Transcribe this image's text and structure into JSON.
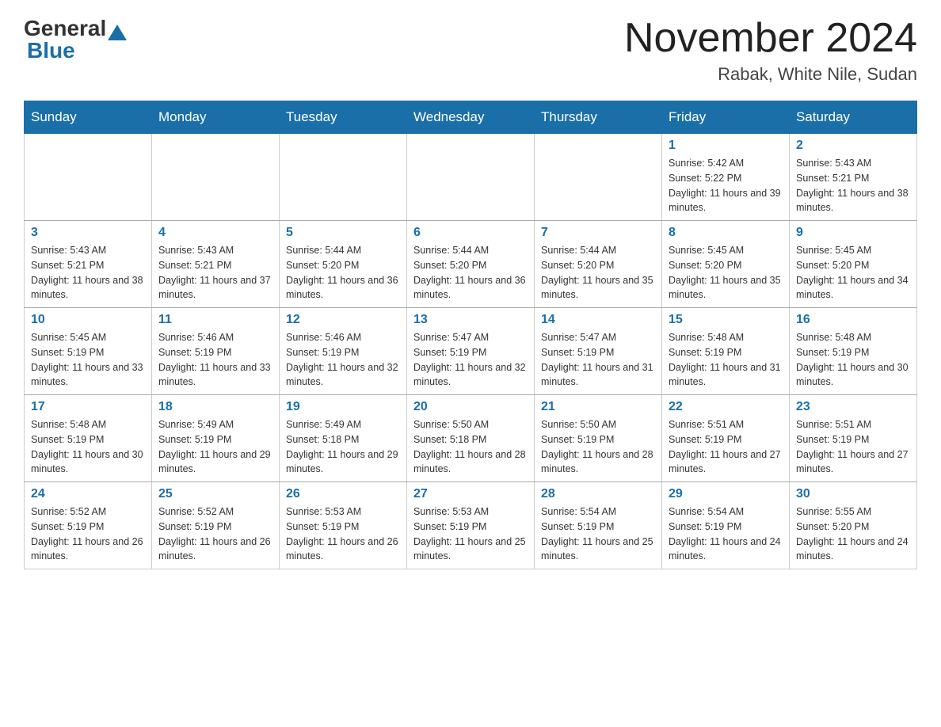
{
  "header": {
    "logo_general": "General",
    "logo_blue": "Blue",
    "month_title": "November 2024",
    "location": "Rabak, White Nile, Sudan"
  },
  "days_of_week": [
    "Sunday",
    "Monday",
    "Tuesday",
    "Wednesday",
    "Thursday",
    "Friday",
    "Saturday"
  ],
  "weeks": [
    [
      {
        "day": "",
        "sunrise": "",
        "sunset": "",
        "daylight": ""
      },
      {
        "day": "",
        "sunrise": "",
        "sunset": "",
        "daylight": ""
      },
      {
        "day": "",
        "sunrise": "",
        "sunset": "",
        "daylight": ""
      },
      {
        "day": "",
        "sunrise": "",
        "sunset": "",
        "daylight": ""
      },
      {
        "day": "",
        "sunrise": "",
        "sunset": "",
        "daylight": ""
      },
      {
        "day": "1",
        "sunrise": "Sunrise: 5:42 AM",
        "sunset": "Sunset: 5:22 PM",
        "daylight": "Daylight: 11 hours and 39 minutes."
      },
      {
        "day": "2",
        "sunrise": "Sunrise: 5:43 AM",
        "sunset": "Sunset: 5:21 PM",
        "daylight": "Daylight: 11 hours and 38 minutes."
      }
    ],
    [
      {
        "day": "3",
        "sunrise": "Sunrise: 5:43 AM",
        "sunset": "Sunset: 5:21 PM",
        "daylight": "Daylight: 11 hours and 38 minutes."
      },
      {
        "day": "4",
        "sunrise": "Sunrise: 5:43 AM",
        "sunset": "Sunset: 5:21 PM",
        "daylight": "Daylight: 11 hours and 37 minutes."
      },
      {
        "day": "5",
        "sunrise": "Sunrise: 5:44 AM",
        "sunset": "Sunset: 5:20 PM",
        "daylight": "Daylight: 11 hours and 36 minutes."
      },
      {
        "day": "6",
        "sunrise": "Sunrise: 5:44 AM",
        "sunset": "Sunset: 5:20 PM",
        "daylight": "Daylight: 11 hours and 36 minutes."
      },
      {
        "day": "7",
        "sunrise": "Sunrise: 5:44 AM",
        "sunset": "Sunset: 5:20 PM",
        "daylight": "Daylight: 11 hours and 35 minutes."
      },
      {
        "day": "8",
        "sunrise": "Sunrise: 5:45 AM",
        "sunset": "Sunset: 5:20 PM",
        "daylight": "Daylight: 11 hours and 35 minutes."
      },
      {
        "day": "9",
        "sunrise": "Sunrise: 5:45 AM",
        "sunset": "Sunset: 5:20 PM",
        "daylight": "Daylight: 11 hours and 34 minutes."
      }
    ],
    [
      {
        "day": "10",
        "sunrise": "Sunrise: 5:45 AM",
        "sunset": "Sunset: 5:19 PM",
        "daylight": "Daylight: 11 hours and 33 minutes."
      },
      {
        "day": "11",
        "sunrise": "Sunrise: 5:46 AM",
        "sunset": "Sunset: 5:19 PM",
        "daylight": "Daylight: 11 hours and 33 minutes."
      },
      {
        "day": "12",
        "sunrise": "Sunrise: 5:46 AM",
        "sunset": "Sunset: 5:19 PM",
        "daylight": "Daylight: 11 hours and 32 minutes."
      },
      {
        "day": "13",
        "sunrise": "Sunrise: 5:47 AM",
        "sunset": "Sunset: 5:19 PM",
        "daylight": "Daylight: 11 hours and 32 minutes."
      },
      {
        "day": "14",
        "sunrise": "Sunrise: 5:47 AM",
        "sunset": "Sunset: 5:19 PM",
        "daylight": "Daylight: 11 hours and 31 minutes."
      },
      {
        "day": "15",
        "sunrise": "Sunrise: 5:48 AM",
        "sunset": "Sunset: 5:19 PM",
        "daylight": "Daylight: 11 hours and 31 minutes."
      },
      {
        "day": "16",
        "sunrise": "Sunrise: 5:48 AM",
        "sunset": "Sunset: 5:19 PM",
        "daylight": "Daylight: 11 hours and 30 minutes."
      }
    ],
    [
      {
        "day": "17",
        "sunrise": "Sunrise: 5:48 AM",
        "sunset": "Sunset: 5:19 PM",
        "daylight": "Daylight: 11 hours and 30 minutes."
      },
      {
        "day": "18",
        "sunrise": "Sunrise: 5:49 AM",
        "sunset": "Sunset: 5:19 PM",
        "daylight": "Daylight: 11 hours and 29 minutes."
      },
      {
        "day": "19",
        "sunrise": "Sunrise: 5:49 AM",
        "sunset": "Sunset: 5:18 PM",
        "daylight": "Daylight: 11 hours and 29 minutes."
      },
      {
        "day": "20",
        "sunrise": "Sunrise: 5:50 AM",
        "sunset": "Sunset: 5:18 PM",
        "daylight": "Daylight: 11 hours and 28 minutes."
      },
      {
        "day": "21",
        "sunrise": "Sunrise: 5:50 AM",
        "sunset": "Sunset: 5:19 PM",
        "daylight": "Daylight: 11 hours and 28 minutes."
      },
      {
        "day": "22",
        "sunrise": "Sunrise: 5:51 AM",
        "sunset": "Sunset: 5:19 PM",
        "daylight": "Daylight: 11 hours and 27 minutes."
      },
      {
        "day": "23",
        "sunrise": "Sunrise: 5:51 AM",
        "sunset": "Sunset: 5:19 PM",
        "daylight": "Daylight: 11 hours and 27 minutes."
      }
    ],
    [
      {
        "day": "24",
        "sunrise": "Sunrise: 5:52 AM",
        "sunset": "Sunset: 5:19 PM",
        "daylight": "Daylight: 11 hours and 26 minutes."
      },
      {
        "day": "25",
        "sunrise": "Sunrise: 5:52 AM",
        "sunset": "Sunset: 5:19 PM",
        "daylight": "Daylight: 11 hours and 26 minutes."
      },
      {
        "day": "26",
        "sunrise": "Sunrise: 5:53 AM",
        "sunset": "Sunset: 5:19 PM",
        "daylight": "Daylight: 11 hours and 26 minutes."
      },
      {
        "day": "27",
        "sunrise": "Sunrise: 5:53 AM",
        "sunset": "Sunset: 5:19 PM",
        "daylight": "Daylight: 11 hours and 25 minutes."
      },
      {
        "day": "28",
        "sunrise": "Sunrise: 5:54 AM",
        "sunset": "Sunset: 5:19 PM",
        "daylight": "Daylight: 11 hours and 25 minutes."
      },
      {
        "day": "29",
        "sunrise": "Sunrise: 5:54 AM",
        "sunset": "Sunset: 5:19 PM",
        "daylight": "Daylight: 11 hours and 24 minutes."
      },
      {
        "day": "30",
        "sunrise": "Sunrise: 5:55 AM",
        "sunset": "Sunset: 5:20 PM",
        "daylight": "Daylight: 11 hours and 24 minutes."
      }
    ]
  ]
}
